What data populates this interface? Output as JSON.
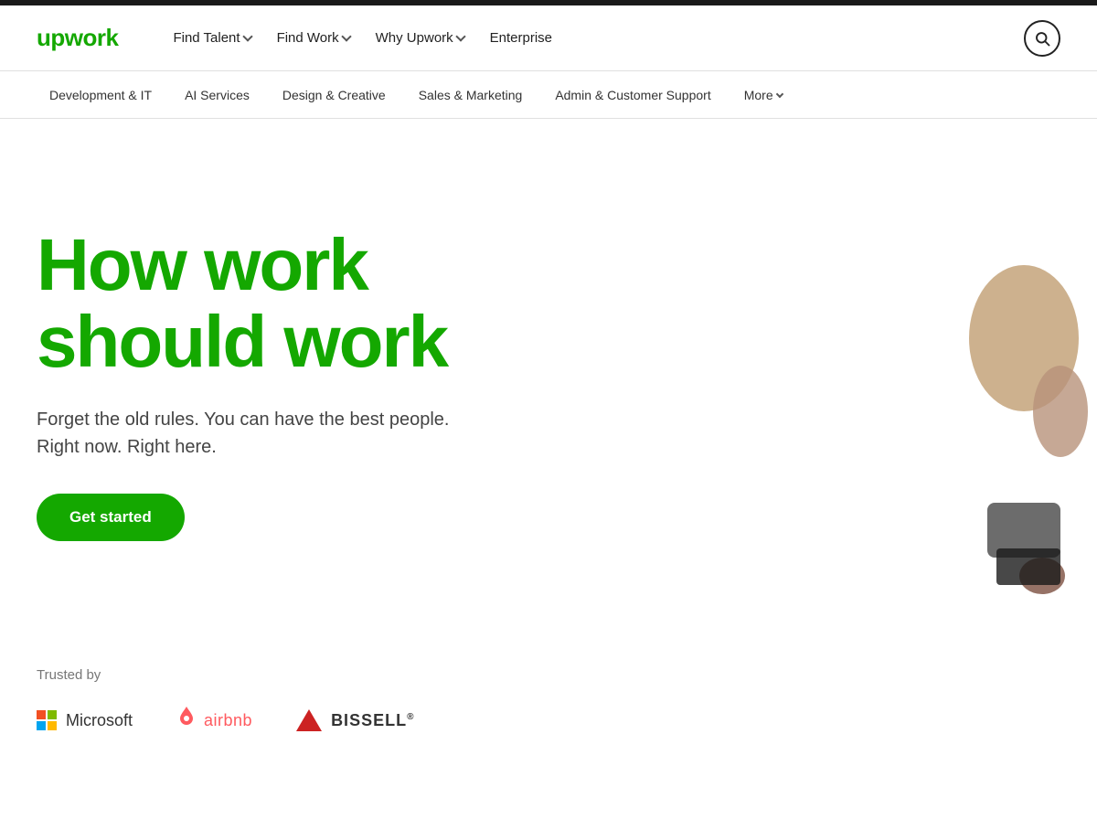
{
  "topBar": {},
  "mainNav": {
    "logo": "upwork",
    "items": [
      {
        "label": "Find Talent",
        "hasChevron": true
      },
      {
        "label": "Find Work",
        "hasChevron": true
      },
      {
        "label": "Why Upwork",
        "hasChevron": true
      },
      {
        "label": "Enterprise",
        "hasChevron": false
      }
    ]
  },
  "secondaryNav": {
    "items": [
      {
        "label": "Development & IT",
        "hasChevron": false
      },
      {
        "label": "AI Services",
        "hasChevron": false
      },
      {
        "label": "Design & Creative",
        "hasChevron": false
      },
      {
        "label": "Sales & Marketing",
        "hasChevron": false
      },
      {
        "label": "Admin & Customer Support",
        "hasChevron": false
      },
      {
        "label": "More",
        "hasChevron": true
      }
    ]
  },
  "hero": {
    "title": "How work\nshould work",
    "subtitle": "Forget the old rules. You can have the best people.\nRight now. Right here.",
    "cta": "Get started"
  },
  "trusted": {
    "label": "Trusted by",
    "logos": [
      {
        "name": "Microsoft"
      },
      {
        "name": "airbnb"
      },
      {
        "name": "Bissell"
      }
    ]
  }
}
